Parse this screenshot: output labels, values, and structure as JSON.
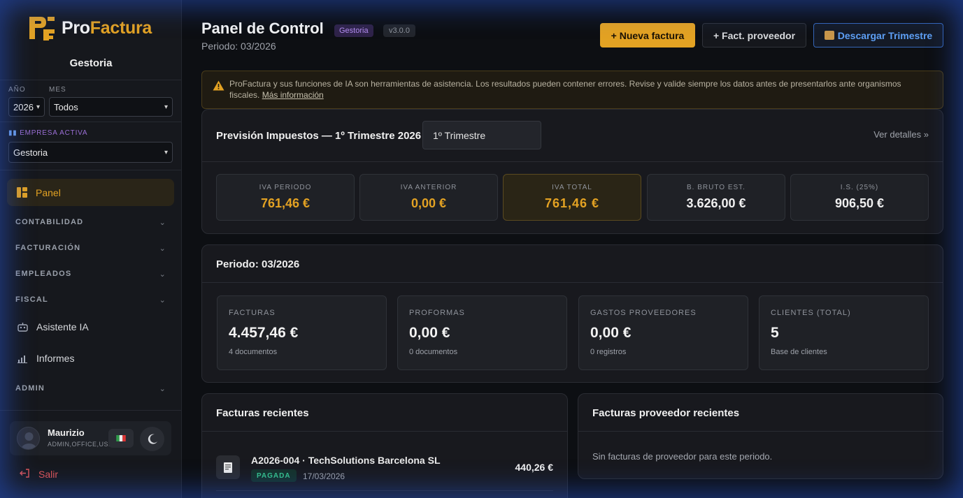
{
  "brand": {
    "pro": "Pro",
    "factura": "Factura",
    "org": "Gestoria"
  },
  "filters": {
    "year_label": "AÑO",
    "year_value": "2026",
    "month_label": "MES",
    "month_value": "Todos",
    "empresa_label": "EMPRESA ACTIVA",
    "empresa_value": "Gestoria"
  },
  "nav": {
    "panel": "Panel",
    "contabilidad": "CONTABILIDAD",
    "facturacion": "FACTURACIÓN",
    "empleados": "EMPLEADOS",
    "fiscal": "FISCAL",
    "asistente": "Asistente IA",
    "informes": "Informes",
    "admin": "ADMIN"
  },
  "user": {
    "name": "Maurizio",
    "role": "ADMIN,OFFICE,USER",
    "logout": "Salir"
  },
  "header": {
    "title": "Panel de Control",
    "badge": "Gestoria",
    "version": "v3.0.0",
    "periodo": "Periodo: 03/2026",
    "btn_nueva": "+ Nueva factura",
    "btn_proveedor": "+ Fact. proveedor",
    "btn_descargar": "Descargar Trimestre"
  },
  "alert": {
    "text": "ProFactura y sus funciones de IA son herramientas de asistencia. Los resultados pueden contener errores. Revise y valide siempre los datos antes de presentarlos ante organismos fiscales.",
    "link": "Más información"
  },
  "prevision": {
    "title": "Previsión Impuestos — 1º Trimestre 2026",
    "select": "1º Trimestre",
    "details": "Ver detalles »",
    "boxes": [
      {
        "label": "IVA PERIODO",
        "value": "761,46 €"
      },
      {
        "label": "IVA ANTERIOR",
        "value": "0,00 €"
      },
      {
        "label": "IVA TOTAL",
        "value": "761,46 €"
      },
      {
        "label": "B. BRUTO EST.",
        "value": "3.626,00 €"
      },
      {
        "label": "I.S. (25%)",
        "value": "906,50 €"
      }
    ]
  },
  "periodo": {
    "title": "Periodo: 03/2026",
    "stats": [
      {
        "label": "FACTURAS",
        "value": "4.457,46 €",
        "sub": "4 documentos"
      },
      {
        "label": "PROFORMAS",
        "value": "0,00 €",
        "sub": "0 documentos"
      },
      {
        "label": "GASTOS PROVEEDORES",
        "value": "0,00 €",
        "sub": "0 registros"
      },
      {
        "label": "CLIENTES (TOTAL)",
        "value": "5",
        "sub": "Base de clientes"
      }
    ]
  },
  "recientes": {
    "title": "Facturas recientes",
    "rows": [
      {
        "title": "A2026-004 · TechSolutions Barcelona SL",
        "status": "PAGADA",
        "date": "17/03/2026",
        "amount": "440,26 €"
      }
    ]
  },
  "proveedor": {
    "title": "Facturas proveedor recientes",
    "empty": "Sin facturas de proveedor para este periodo."
  },
  "colors": {
    "accent": "#e3a223",
    "purple": "#9b6fd6",
    "blue": "#5ea0f5",
    "success": "#36c28a",
    "danger": "#e05555"
  }
}
